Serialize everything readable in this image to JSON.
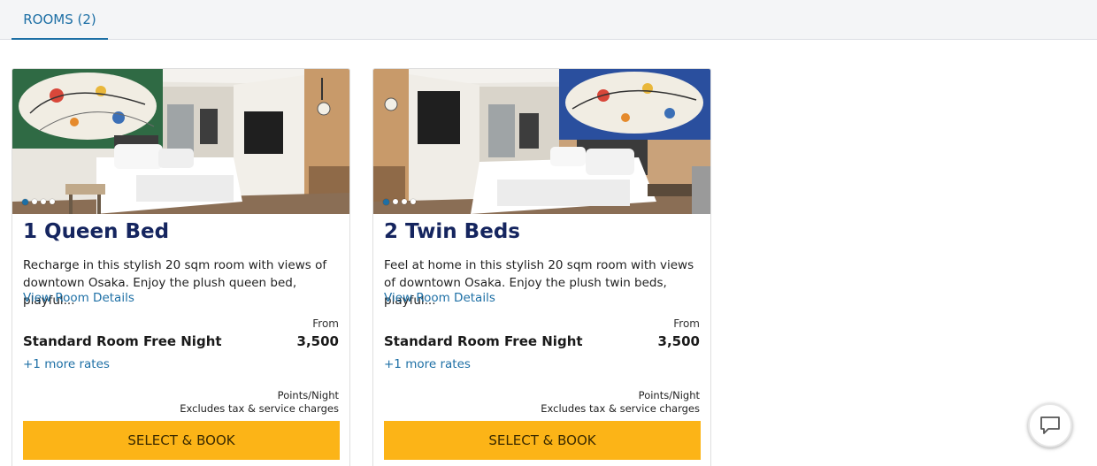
{
  "tabs": [
    {
      "label": "ROOMS (2)",
      "active": true
    }
  ],
  "rooms": [
    {
      "title": "1 Queen Bed",
      "description": "Recharge in this stylish 20 sqm room with views of downtown Osaka. Enjoy the plush queen bed, playful...",
      "details_link": "View Room Details",
      "from_label": "From",
      "rate_name": "Standard Room Free Night",
      "price": "3,500",
      "more_rates": "+1 more rates",
      "price_unit": "Points/Night",
      "price_note": "Excludes tax & service charges",
      "book_label": "SELECT & BOOK",
      "photo_dots": 4,
      "active_dot": 1
    },
    {
      "title": "2 Twin Beds",
      "description": "Feel at home in this stylish 20 sqm room with views of downtown Osaka. Enjoy the plush twin beds, playful...",
      "details_link": "View Room Details",
      "from_label": "From",
      "rate_name": "Standard Room Free Night",
      "price": "3,500",
      "more_rates": "+1 more rates",
      "price_unit": "Points/Night",
      "price_note": "Excludes tax & service charges",
      "book_label": "SELECT & BOOK",
      "photo_dots": 4,
      "active_dot": 1
    }
  ],
  "icons": {
    "chat": "chat-bubble-icon"
  },
  "colors": {
    "accent": "#1d6fa5",
    "title": "#15255f",
    "book_button": "#fcb417"
  }
}
